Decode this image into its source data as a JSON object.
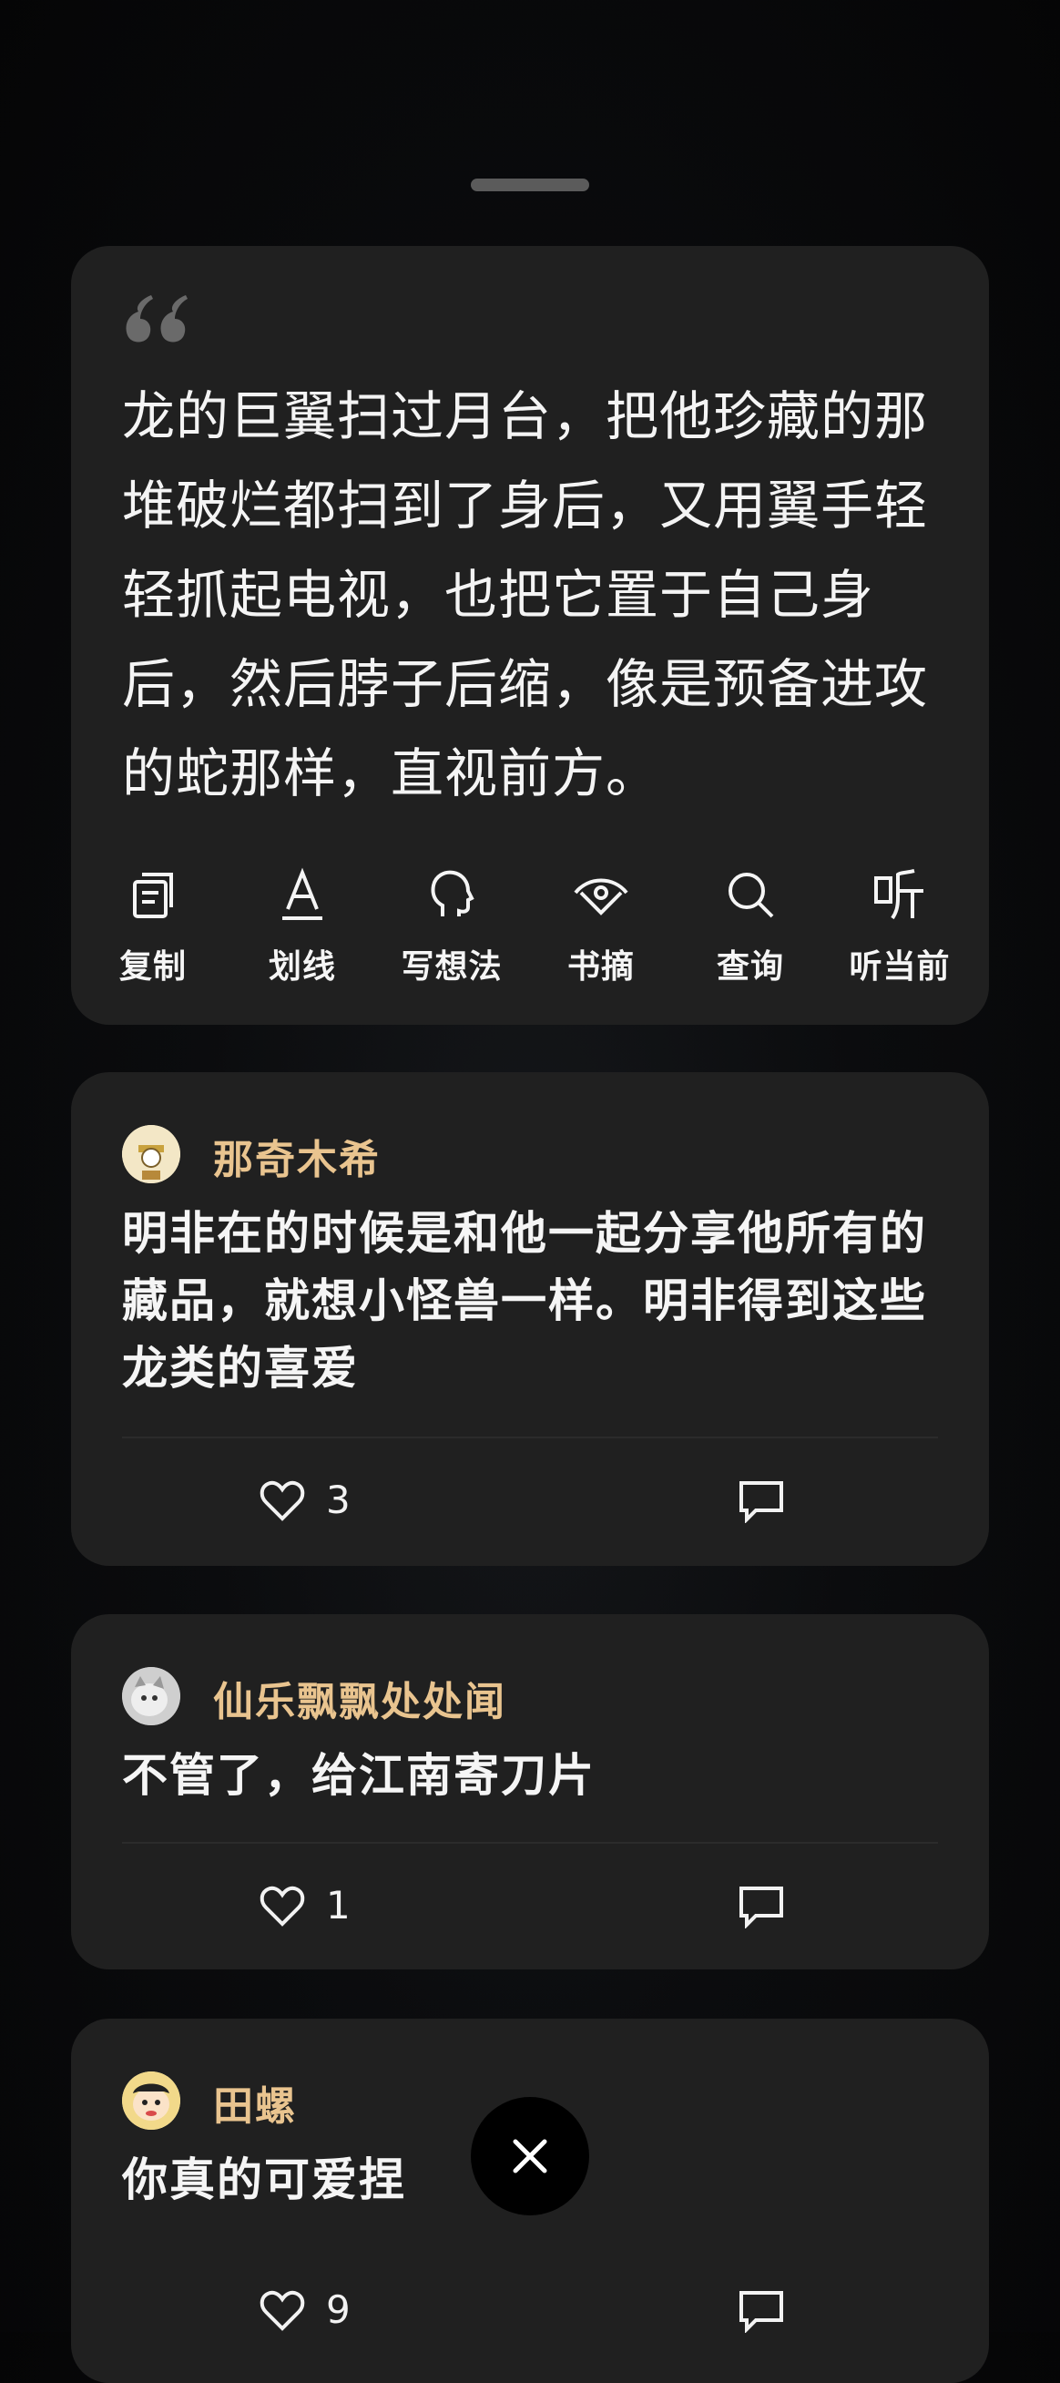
{
  "quote": {
    "text": "龙的巨翼扫过月台，把他珍藏的那堆破烂都扫到了身后，又用翼手轻轻抓起电视，也把它置于自己身后，然后脖子后缩，像是预备进攻的蛇那样，直视前方。"
  },
  "toolbar": {
    "copy": "复制",
    "underline": "划线",
    "note": "写想法",
    "excerpt": "书摘",
    "lookup": "查询",
    "listen": "听当前"
  },
  "comments": [
    {
      "user": "那奇木希",
      "text": "明非在的时候是和他一起分享他所有的藏品，就想小怪兽一样。明非得到这些龙类的喜爱",
      "likes": "3"
    },
    {
      "user": "仙乐飘飘处处闻",
      "text": "不管了，给江南寄刀片",
      "likes": "1"
    },
    {
      "user": "田螺",
      "text": "你真的可爱捏",
      "likes": "9"
    }
  ],
  "colors": {
    "username": "#e9c48f",
    "card": "#202020"
  },
  "icons": {
    "close": "close-icon",
    "like": "heart-icon",
    "reply": "comment-icon"
  }
}
